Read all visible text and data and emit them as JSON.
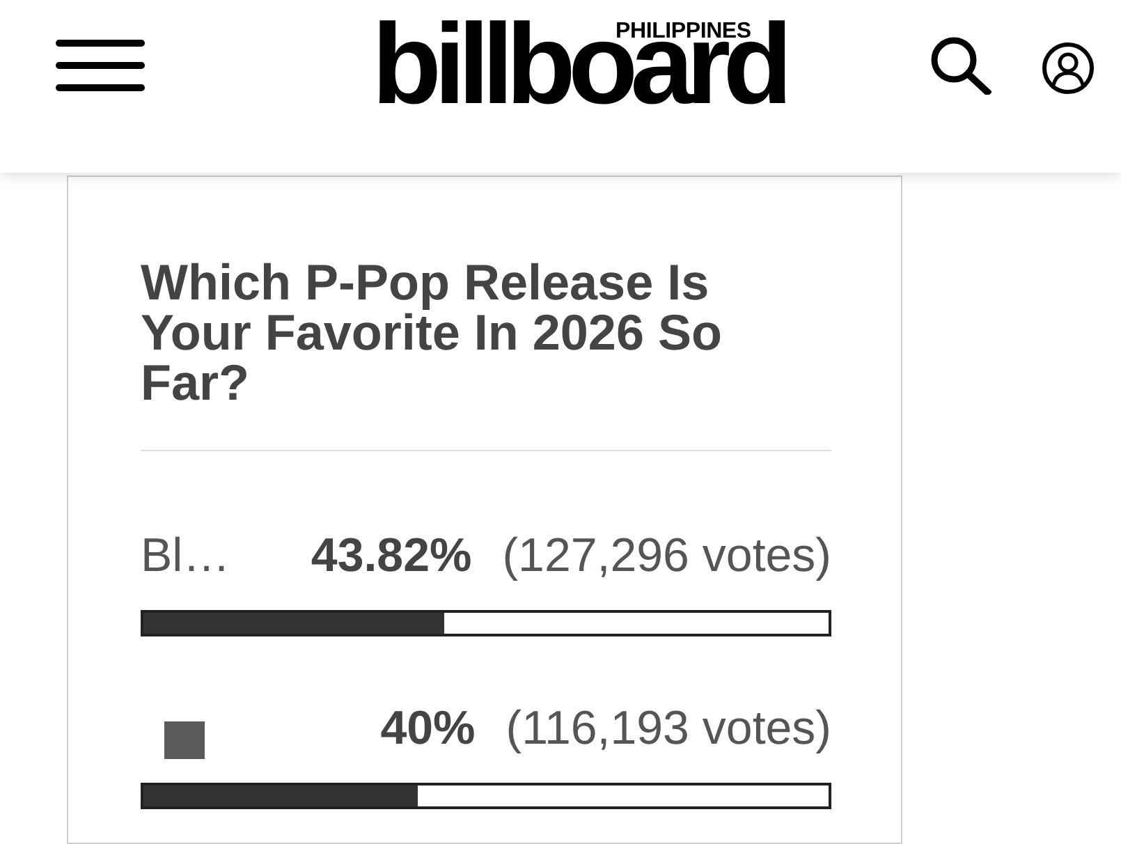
{
  "header": {
    "logo": "billboard",
    "logo_edition": "PHILIPPINES"
  },
  "poll": {
    "question": "Which P-Pop Release Is Your Favorite In 2026 So Far?",
    "options": [
      {
        "kind": "text",
        "label": "Bl…",
        "percentage": "43.82%",
        "votes": "(127,296 votes)",
        "level": 0.4382
      },
      {
        "kind": "image",
        "percentage": "40%",
        "votes": "(116,193 votes)",
        "level": 0.4
      }
    ]
  }
}
